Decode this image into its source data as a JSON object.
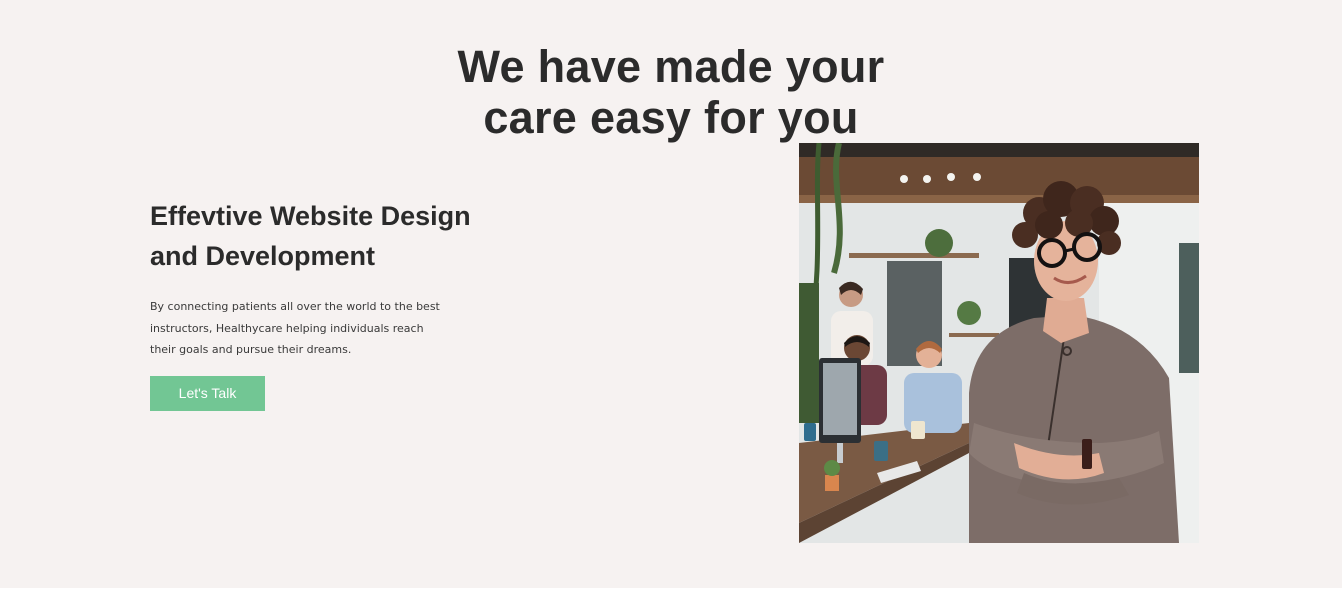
{
  "hero": {
    "headline_line1": "We have made your",
    "headline_line2": "care easy for you"
  },
  "feature": {
    "title_line1": "Effevtive Website Design",
    "title_line2": "and Development",
    "description": "By connecting patients all over the world to the best instructors, Healthycare helping individuals reach their goals and pursue their dreams.",
    "cta_label": "Let's Talk"
  },
  "colors": {
    "background": "#f6f2f1",
    "heading": "#2b2b2b",
    "accent": "#72c694"
  },
  "image": {
    "alt": "Smiling woman with curly hair and glasses standing with arms crossed in an office with colleagues working behind her"
  }
}
